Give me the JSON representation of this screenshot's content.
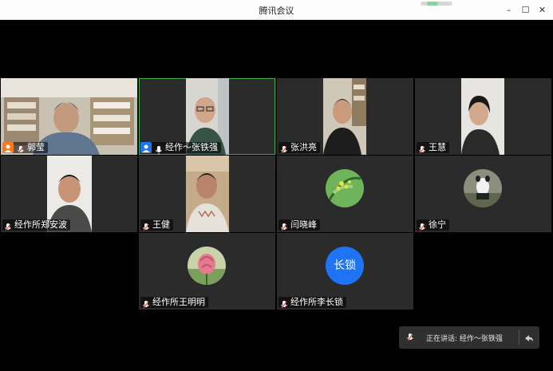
{
  "window": {
    "title": "腾讯会议",
    "controls": {
      "minimize": "–",
      "maximize": "☐",
      "close": "✕"
    }
  },
  "participants": [
    {
      "name": "郭莹",
      "host": true
    },
    {
      "name": "经作～张铁强",
      "host": true
    },
    {
      "name": "张洪亮"
    },
    {
      "name": "王慧"
    },
    {
      "name": "经作所郑安波"
    },
    {
      "name": "王健"
    },
    {
      "name": "闫晓峰"
    },
    {
      "name": "徐宁"
    },
    {
      "name": "经作所王明明"
    },
    {
      "name": "经作所李长锁",
      "avatar_text": "长锁"
    }
  ],
  "speaking": {
    "text": "正在讲话: 经作～张铁强"
  },
  "colors": {
    "tile_bg": "#2b2b2b",
    "accent_blue": "#1e74f5",
    "host_orange": "#ff7a1a",
    "active_border": "#3fae3f"
  }
}
